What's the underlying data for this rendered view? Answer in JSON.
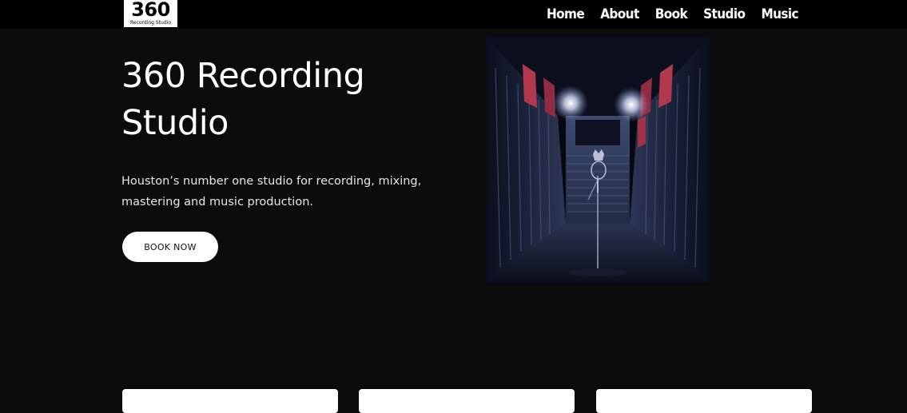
{
  "logo": {
    "number": "360",
    "subtitle": "Recording Studio"
  },
  "nav": {
    "items": [
      {
        "label": "Home"
      },
      {
        "label": "About"
      },
      {
        "label": "Book"
      },
      {
        "label": "Studio"
      },
      {
        "label": "Music"
      }
    ]
  },
  "hero": {
    "title_line1": "360 Recording",
    "title_line2": "Studio",
    "subtitle_line1": "Houston’s number one studio for recording, mixing,",
    "subtitle_line2": "mastering and music production.",
    "button_label": "BOOK NOW"
  },
  "colors": {
    "background": "#0b0b0b",
    "header": "#000000",
    "button": "#ffffff",
    "accent_panels": "#b0384f"
  }
}
